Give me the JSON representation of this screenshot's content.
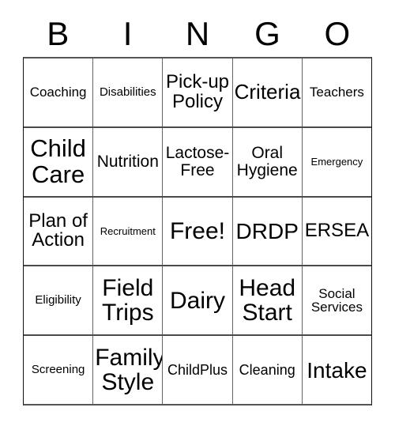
{
  "card": {
    "title": "BINGO Card",
    "free_space_index": {
      "row": 2,
      "col": 2
    },
    "text_color": "#000000",
    "background_color": "#ffffff",
    "border_color": "#4a4a4a"
  },
  "header": {
    "letters": [
      "B",
      "I",
      "N",
      "G",
      "O"
    ]
  },
  "grid": {
    "columns": 5,
    "rows": 5,
    "cells": [
      [
        {
          "label": "Coaching",
          "size": "fs-md"
        },
        {
          "label": "Disabilities",
          "size": "fs-sm"
        },
        {
          "label": "Pick-up\nPolicy",
          "size": "fs-2xl"
        },
        {
          "label": "Criteria",
          "size": "fs-3xl"
        },
        {
          "label": "Teachers",
          "size": "fs-md"
        }
      ],
      [
        {
          "label": "Child\nCare",
          "size": "fs-6xl"
        },
        {
          "label": "Nutrition",
          "size": "fs-xl"
        },
        {
          "label": "Lactose-\nFree",
          "size": "fs-xl"
        },
        {
          "label": "Oral\nHygiene",
          "size": "fs-xl"
        },
        {
          "label": "Emergency",
          "size": "fs-xs"
        }
      ],
      [
        {
          "label": "Plan of\nAction",
          "size": "fs-2xl"
        },
        {
          "label": "Recruitment",
          "size": "fs-xs"
        },
        {
          "label": "Free!",
          "size": "fs-5xl"
        },
        {
          "label": "DRDP",
          "size": "fs-4xl"
        },
        {
          "label": "ERSEA",
          "size": "fs-2xl"
        }
      ],
      [
        {
          "label": "Eligibility",
          "size": "fs-sm"
        },
        {
          "label": "Field\nTrips",
          "size": "fs-5xl"
        },
        {
          "label": "Dairy",
          "size": "fs-5xl"
        },
        {
          "label": "Head\nStart",
          "size": "fs-5xl"
        },
        {
          "label": "Social\nServices",
          "size": "fs-md"
        }
      ],
      [
        {
          "label": "Screening",
          "size": "fs-sm"
        },
        {
          "label": "Family\nStyle",
          "size": "fs-5xl"
        },
        {
          "label": "ChildPlus",
          "size": "fs-lg"
        },
        {
          "label": "Cleaning",
          "size": "fs-lg"
        },
        {
          "label": "Intake",
          "size": "fs-4xl"
        }
      ]
    ]
  }
}
